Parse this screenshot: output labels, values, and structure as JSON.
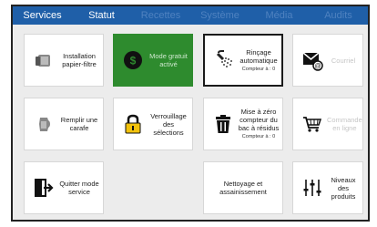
{
  "tabs": [
    "Services",
    "Statut",
    "Recettes",
    "Système",
    "Média",
    "Audits"
  ],
  "tiles": {
    "installation": {
      "label": "Installation papier-filtre"
    },
    "free_mode": {
      "label": "Mode gratuit activé"
    },
    "rinse": {
      "label": "Rinçage automatique",
      "counter": "Compteur à : 0"
    },
    "mail": {
      "label": "Courriel"
    },
    "carafe": {
      "label": "Remplir une carafe"
    },
    "lock": {
      "label": "Verrouillage des sélections"
    },
    "bin": {
      "label": "Mise à zéro compteur du bac à résidus",
      "counter": "Compteur à : 0"
    },
    "order": {
      "label": "Commande en ligne"
    },
    "exit": {
      "label": "Quitter mode service"
    },
    "cleaning": {
      "label": "Nettoyage et assainissement"
    },
    "levels": {
      "label": "Niveaux des produits"
    }
  },
  "colors": {
    "tab_bar": "#1f5fa8",
    "active_tile": "#2e8b2e",
    "disabled_text": "#c6c6c6"
  }
}
